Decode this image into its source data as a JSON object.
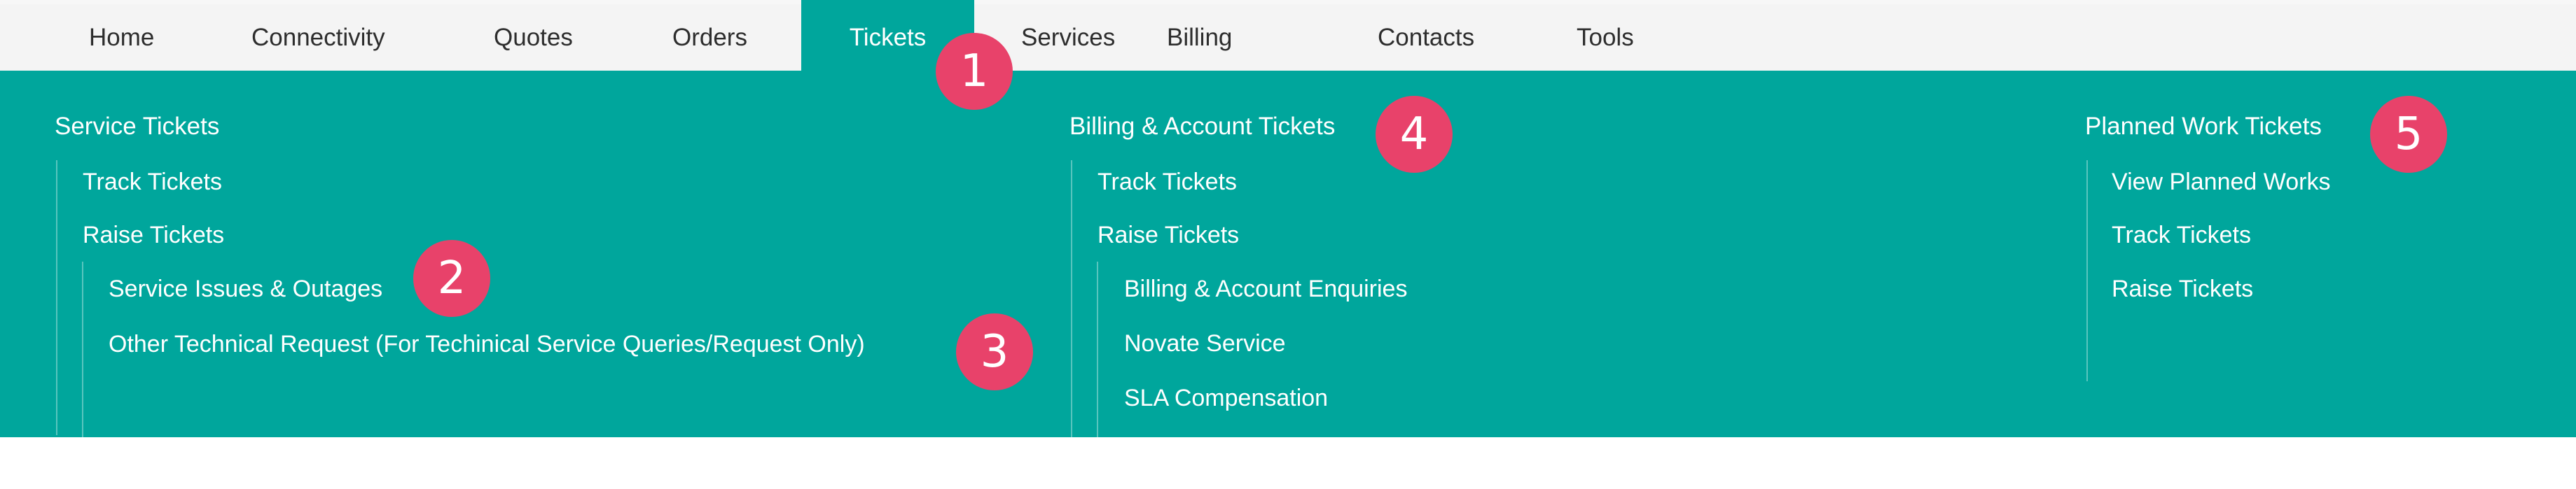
{
  "nav": {
    "items": [
      {
        "label": "Home"
      },
      {
        "label": "Connectivity"
      },
      {
        "label": "Quotes"
      },
      {
        "label": "Orders"
      },
      {
        "label": "Tickets"
      },
      {
        "label": "Services"
      },
      {
        "label": "Billing"
      },
      {
        "label": "Contacts"
      },
      {
        "label": "Tools"
      }
    ],
    "active": "Tickets"
  },
  "menu": {
    "service_tickets": {
      "heading": "Service Tickets",
      "track": "Track Tickets",
      "raise": "Raise Tickets",
      "sub": [
        {
          "label": "Service Issues & Outages"
        },
        {
          "label": "Other Technical Request (For Techinical Service Queries/Request Only)"
        }
      ]
    },
    "billing_tickets": {
      "heading": "Billing & Account Tickets",
      "track": "Track Tickets",
      "raise": "Raise Tickets",
      "sub": [
        {
          "label": "Billing & Account Enquiries"
        },
        {
          "label": "Novate Service"
        },
        {
          "label": "SLA Compensation"
        }
      ]
    },
    "planned_tickets": {
      "heading": "Planned Work Tickets",
      "items": [
        {
          "label": "View Planned Works"
        },
        {
          "label": "Track Tickets"
        },
        {
          "label": "Raise Tickets"
        }
      ]
    }
  },
  "callouts": [
    "1",
    "2",
    "3",
    "4",
    "5"
  ],
  "colors": {
    "accent": "#00a69c",
    "callout": "#e8426a",
    "nav_bg": "#f4f4f4"
  }
}
